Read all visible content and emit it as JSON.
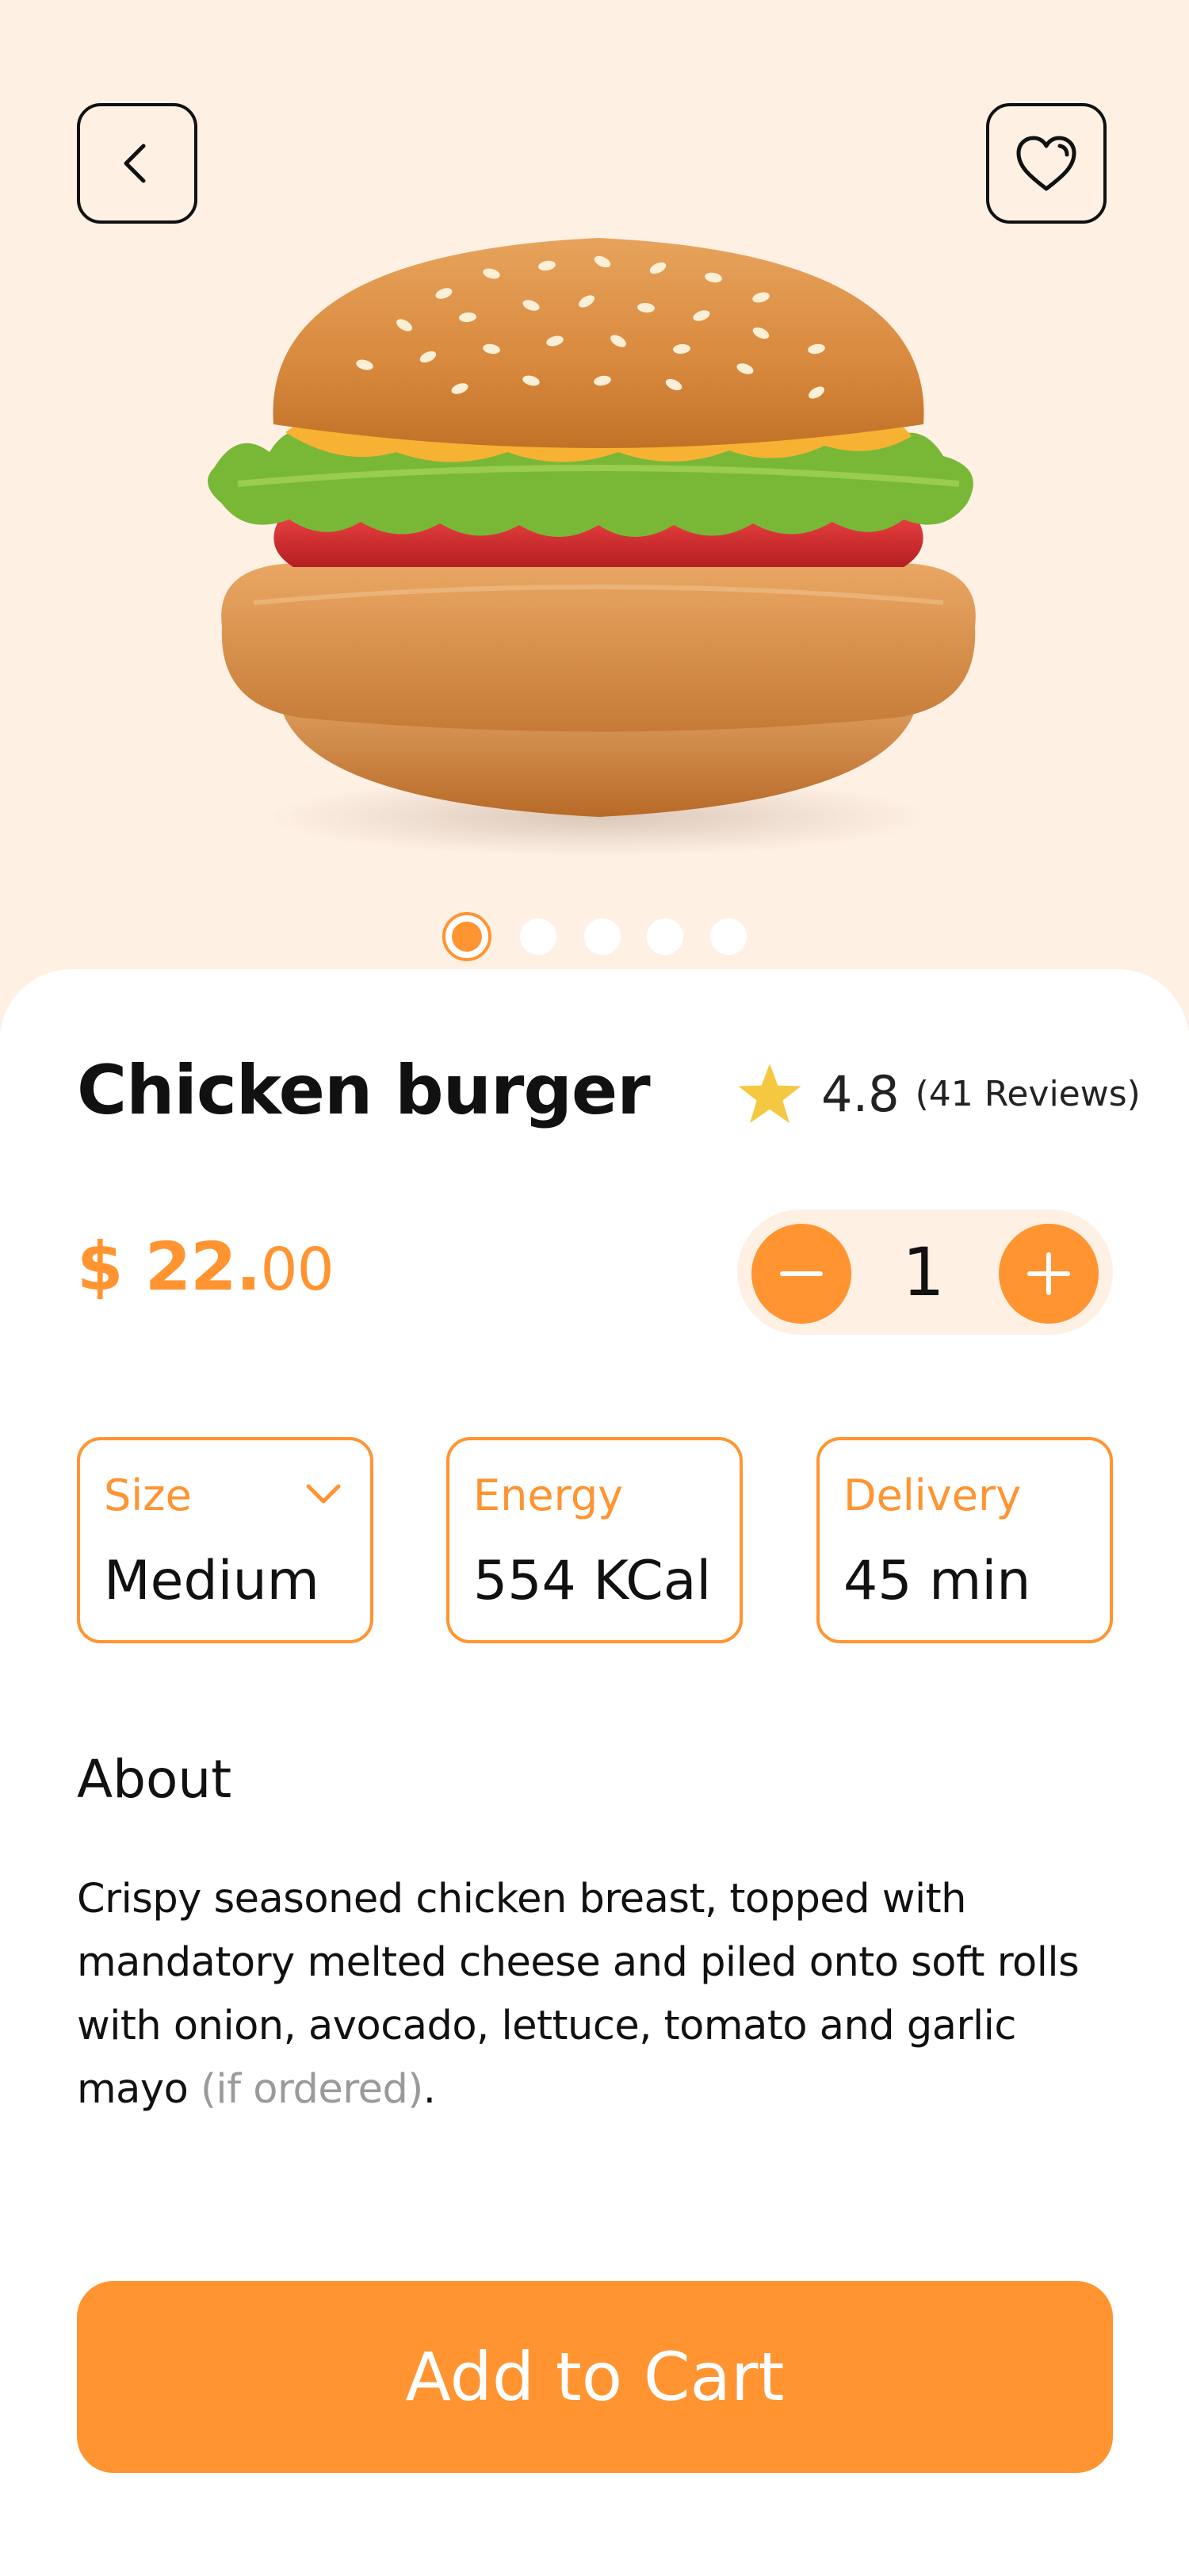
{
  "header": {
    "back_icon": "chevron-left-icon",
    "favorite_icon": "heart-icon"
  },
  "gallery": {
    "image": "chicken-burger-photo",
    "slides": 5,
    "active_slide": 1
  },
  "product": {
    "name": "Chicken burger",
    "rating": "4.8",
    "reviews": "(41 Reviews)",
    "price_main": "$ 22.",
    "price_cents": "00"
  },
  "quantity": {
    "value": "1"
  },
  "info": {
    "size": {
      "label": "Size",
      "value": "Medium"
    },
    "energy": {
      "label": "Energy",
      "value": "554 KCal"
    },
    "delivery": {
      "label": "Delivery",
      "value": "45 min"
    }
  },
  "about": {
    "title": "About",
    "text": "Crispy seasoned chicken breast, topped with mandatory melted cheese and piled onto soft rolls with onion, avocado, lettuce, tomato and garlic mayo ",
    "muted": "(if ordered)",
    "end": "."
  },
  "cart": {
    "label": "Add to Cart"
  },
  "colors": {
    "accent": "#ff9431",
    "hero_bg": "#fff0e4",
    "star": "#f5c842"
  }
}
